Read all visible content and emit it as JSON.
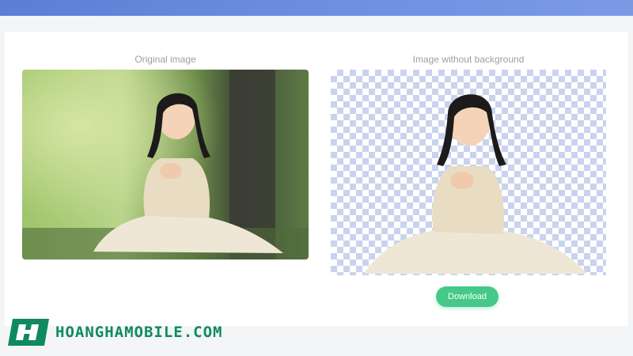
{
  "panels": {
    "original_title": "Original image",
    "result_title": "Image without background"
  },
  "actions": {
    "download_label": "Download"
  },
  "brand": {
    "name": "HOANGHAMOBILE.COM",
    "color": "#0f8a5f"
  },
  "colors": {
    "top_bar": "#6d8ee0",
    "download_button": "#45c98a",
    "checker": "#c9d3ee"
  }
}
